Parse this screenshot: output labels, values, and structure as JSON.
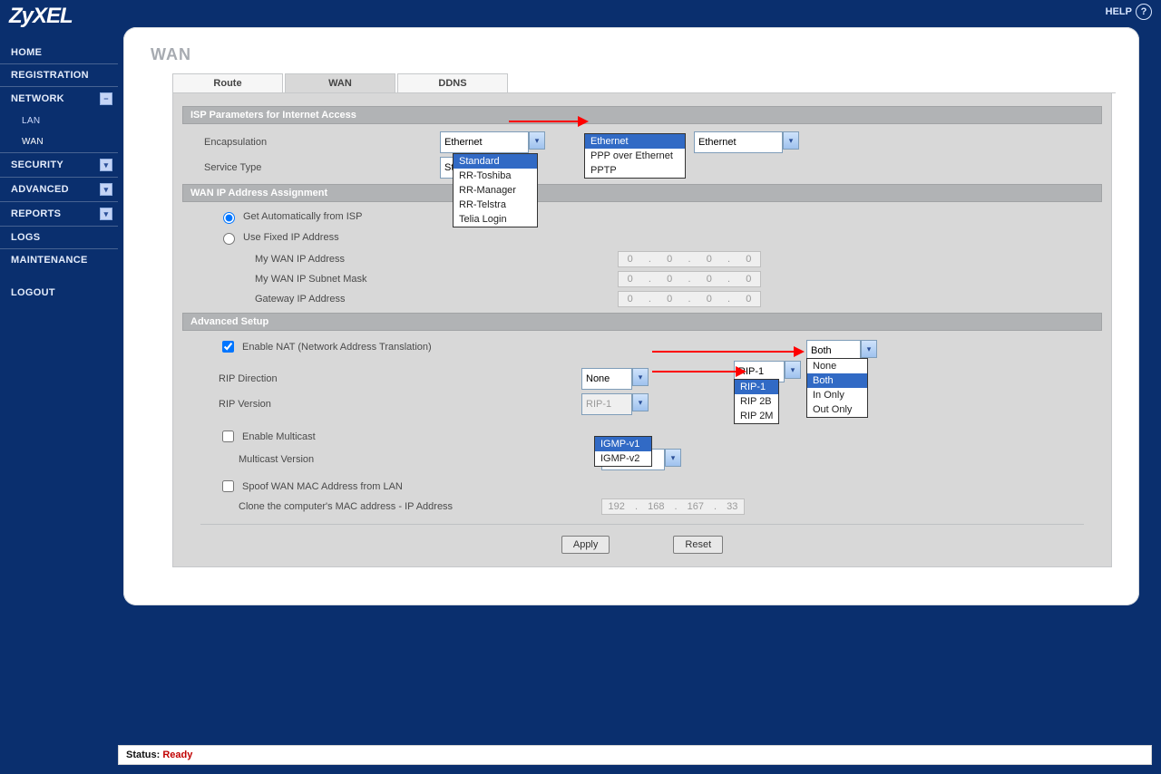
{
  "brand": "ZyXEL",
  "help_label": "HELP",
  "page_title": "WAN",
  "sidebar": [
    {
      "label": "HOME",
      "expand": false
    },
    {
      "label": "REGISTRATION",
      "expand": false
    },
    {
      "label": "NETWORK",
      "expand": true
    },
    {
      "label": "LAN",
      "sub": true
    },
    {
      "label": "WAN",
      "sub": true,
      "active": true
    },
    {
      "label": "SECURITY",
      "expand": true
    },
    {
      "label": "ADVANCED",
      "expand": true
    },
    {
      "label": "REPORTS",
      "expand": true
    },
    {
      "label": "LOGS",
      "expand": false
    },
    {
      "label": "MAINTENANCE",
      "expand": false
    },
    {
      "label": "LOGOUT",
      "expand": false
    }
  ],
  "tabs": {
    "route": "Route",
    "wan": "WAN",
    "ddns": "DDNS"
  },
  "sections": {
    "isp": "ISP Parameters for Internet Access",
    "wanip": "WAN IP Address Assignment",
    "adv": "Advanced Setup"
  },
  "labels": {
    "encapsulation": "Encapsulation",
    "service_type": "Service Type",
    "get_auto": "Get Automatically from ISP",
    "use_fixed": "Use Fixed IP Address",
    "my_wan_ip": "My WAN IP Address",
    "my_subnet": "My WAN IP Subnet Mask",
    "gateway": "Gateway IP Address",
    "enable_nat": "Enable NAT (Network Address Translation)",
    "rip_dir": "RIP Direction",
    "rip_ver": "RIP Version",
    "enable_multicast": "Enable Multicast",
    "multicast_ver": "Multicast Version",
    "spoof_mac": "Spoof WAN MAC Address from LAN",
    "clone_mac": "Clone the computer's MAC address - IP Address"
  },
  "dropdowns": {
    "encapsulation": {
      "value": "Ethernet",
      "options": [
        "Ethernet",
        "PPP over Ethernet",
        "PPTP"
      ],
      "selected": "Ethernet"
    },
    "service_type": {
      "value": "Standard",
      "options": [
        "Standard",
        "RR-Toshiba",
        "RR-Manager",
        "RR-Telstra",
        "Telia Login"
      ],
      "selected": "Standard"
    },
    "rip_direction": {
      "value": "None",
      "options": [
        "None",
        "Both",
        "In Only",
        "Out Only"
      ],
      "selected": "Both",
      "dropdown_label": "Both"
    },
    "rip_version": {
      "value": "RIP-1",
      "options": [
        "RIP-1",
        "RIP 2B",
        "RIP 2M"
      ],
      "selected": "RIP-1",
      "dropdown_label": "RIP-1"
    },
    "multicast": {
      "value": "IGMP-v1",
      "options": [
        "IGMP-v1",
        "IGMP-v2"
      ],
      "selected": "IGMP-v1"
    }
  },
  "ip_fields": {
    "wan_ip": [
      "0",
      "0",
      "0",
      "0"
    ],
    "subnet": [
      "0",
      "0",
      "0",
      "0"
    ],
    "gateway": [
      "0",
      "0",
      "0",
      "0"
    ],
    "clone": [
      "192",
      "168",
      "167",
      "33"
    ]
  },
  "checkboxes": {
    "nat": true,
    "multicast": false,
    "spoof": false
  },
  "radios": {
    "wan_ip_mode": "auto"
  },
  "buttons": {
    "apply": "Apply",
    "reset": "Reset"
  },
  "status": {
    "label": "Status:",
    "value": "Ready"
  }
}
